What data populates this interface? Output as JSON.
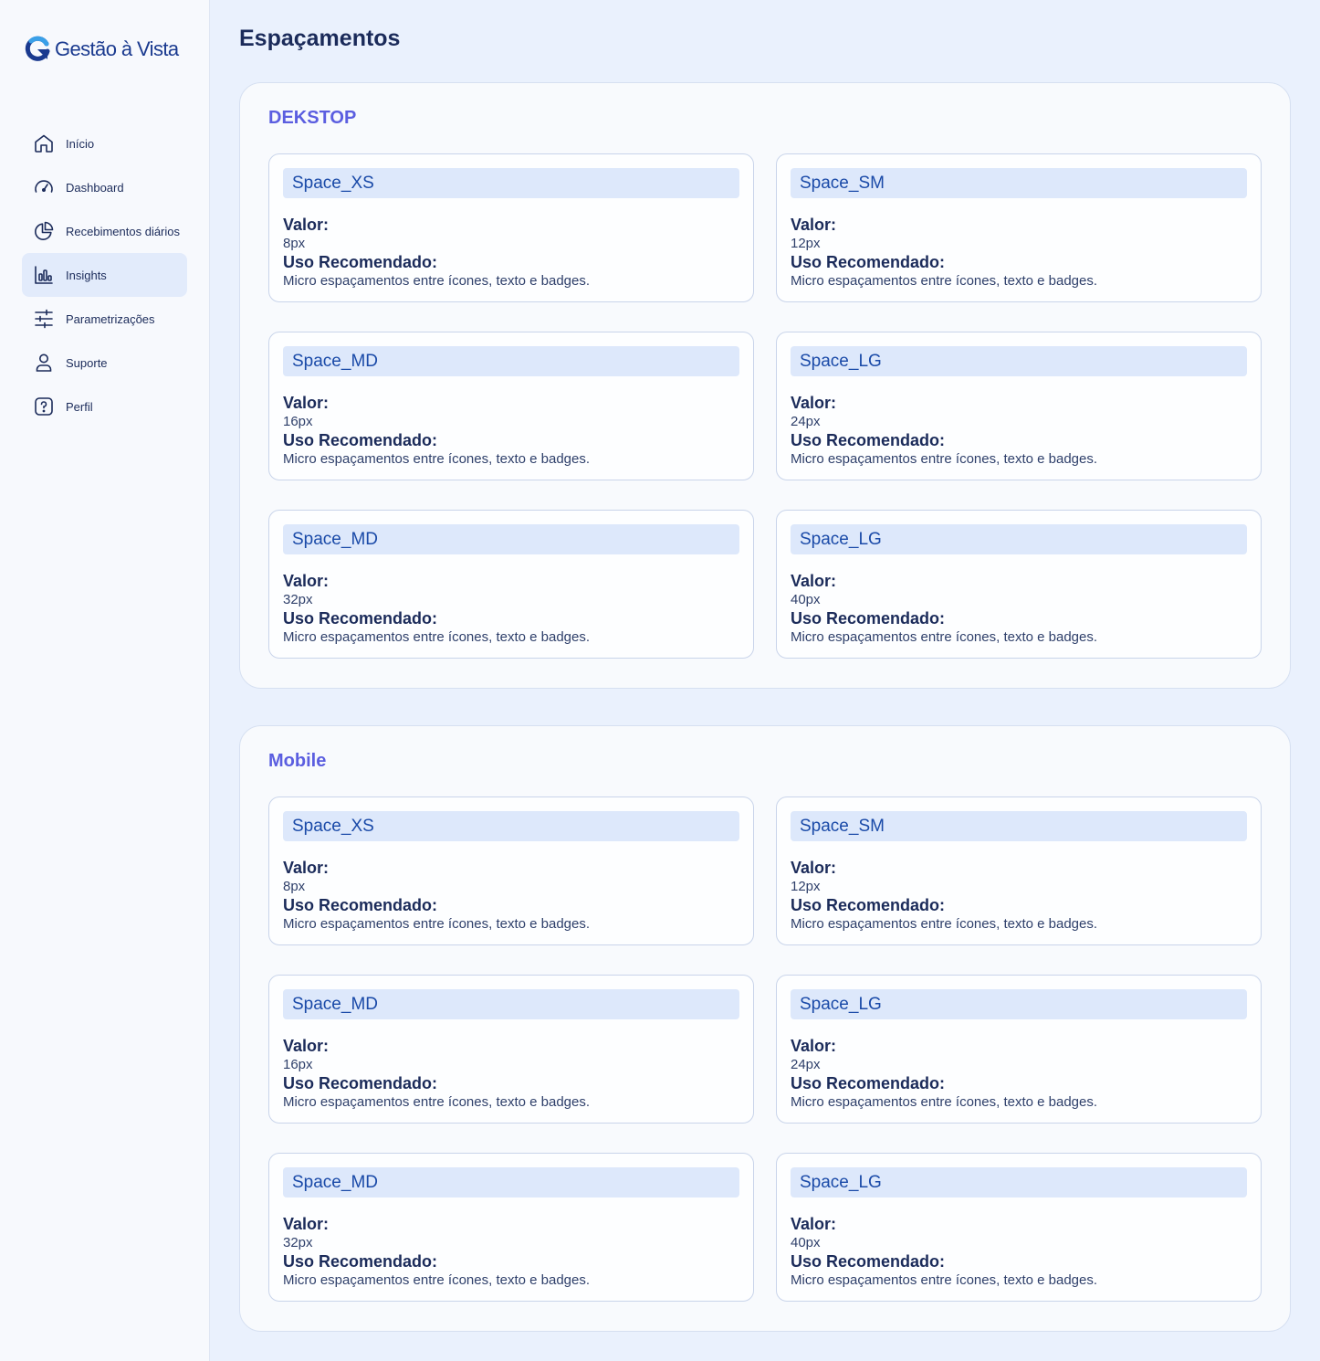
{
  "brand": {
    "name": "Gestão à Vista",
    "color": "#1a3a8f",
    "accent": "#3aa0e8"
  },
  "nav": {
    "items": [
      {
        "label": "Início",
        "icon": "home-icon",
        "active": false
      },
      {
        "label": "Dashboard",
        "icon": "gauge-icon",
        "active": false
      },
      {
        "label": "Recebimentos diários",
        "icon": "pie-chart-icon",
        "active": false
      },
      {
        "label": "Insights",
        "icon": "bar-chart-icon",
        "active": true
      },
      {
        "label": "Parametrizações",
        "icon": "sliders-icon",
        "active": false
      },
      {
        "label": "Suporte",
        "icon": "user-icon",
        "active": false
      },
      {
        "label": "Perfil",
        "icon": "help-icon",
        "active": false
      }
    ]
  },
  "page": {
    "title": "Espaçamentos"
  },
  "labels": {
    "valor": "Valor:",
    "uso": "Uso Recomendado:"
  },
  "sections": [
    {
      "title": "DEKSTOP",
      "cards": [
        {
          "name": "Space_XS",
          "value": "8px",
          "usage": "Micro espaçamentos entre ícones, texto e badges."
        },
        {
          "name": "Space_SM",
          "value": "12px",
          "usage": "Micro espaçamentos entre ícones, texto e badges."
        },
        {
          "name": "Space_MD",
          "value": "16px",
          "usage": "Micro espaçamentos entre ícones, texto e badges."
        },
        {
          "name": "Space_LG",
          "value": "24px",
          "usage": "Micro espaçamentos entre ícones, texto e badges."
        },
        {
          "name": "Space_MD",
          "value": "32px",
          "usage": "Micro espaçamentos entre ícones, texto e badges."
        },
        {
          "name": "Space_LG",
          "value": "40px",
          "usage": "Micro espaçamentos entre ícones, texto e badges."
        }
      ]
    },
    {
      "title": "Mobile",
      "cards": [
        {
          "name": "Space_XS",
          "value": "8px",
          "usage": "Micro espaçamentos entre ícones, texto e badges."
        },
        {
          "name": "Space_SM",
          "value": "12px",
          "usage": "Micro espaçamentos entre ícones, texto e badges."
        },
        {
          "name": "Space_MD",
          "value": "16px",
          "usage": "Micro espaçamentos entre ícones, texto e badges."
        },
        {
          "name": "Space_LG",
          "value": "24px",
          "usage": "Micro espaçamentos entre ícones, texto e badges."
        },
        {
          "name": "Space_MD",
          "value": "32px",
          "usage": "Micro espaçamentos entre ícones, texto e badges."
        },
        {
          "name": "Space_LG",
          "value": "40px",
          "usage": "Micro espaçamentos entre ícones, texto e badges."
        }
      ]
    }
  ]
}
